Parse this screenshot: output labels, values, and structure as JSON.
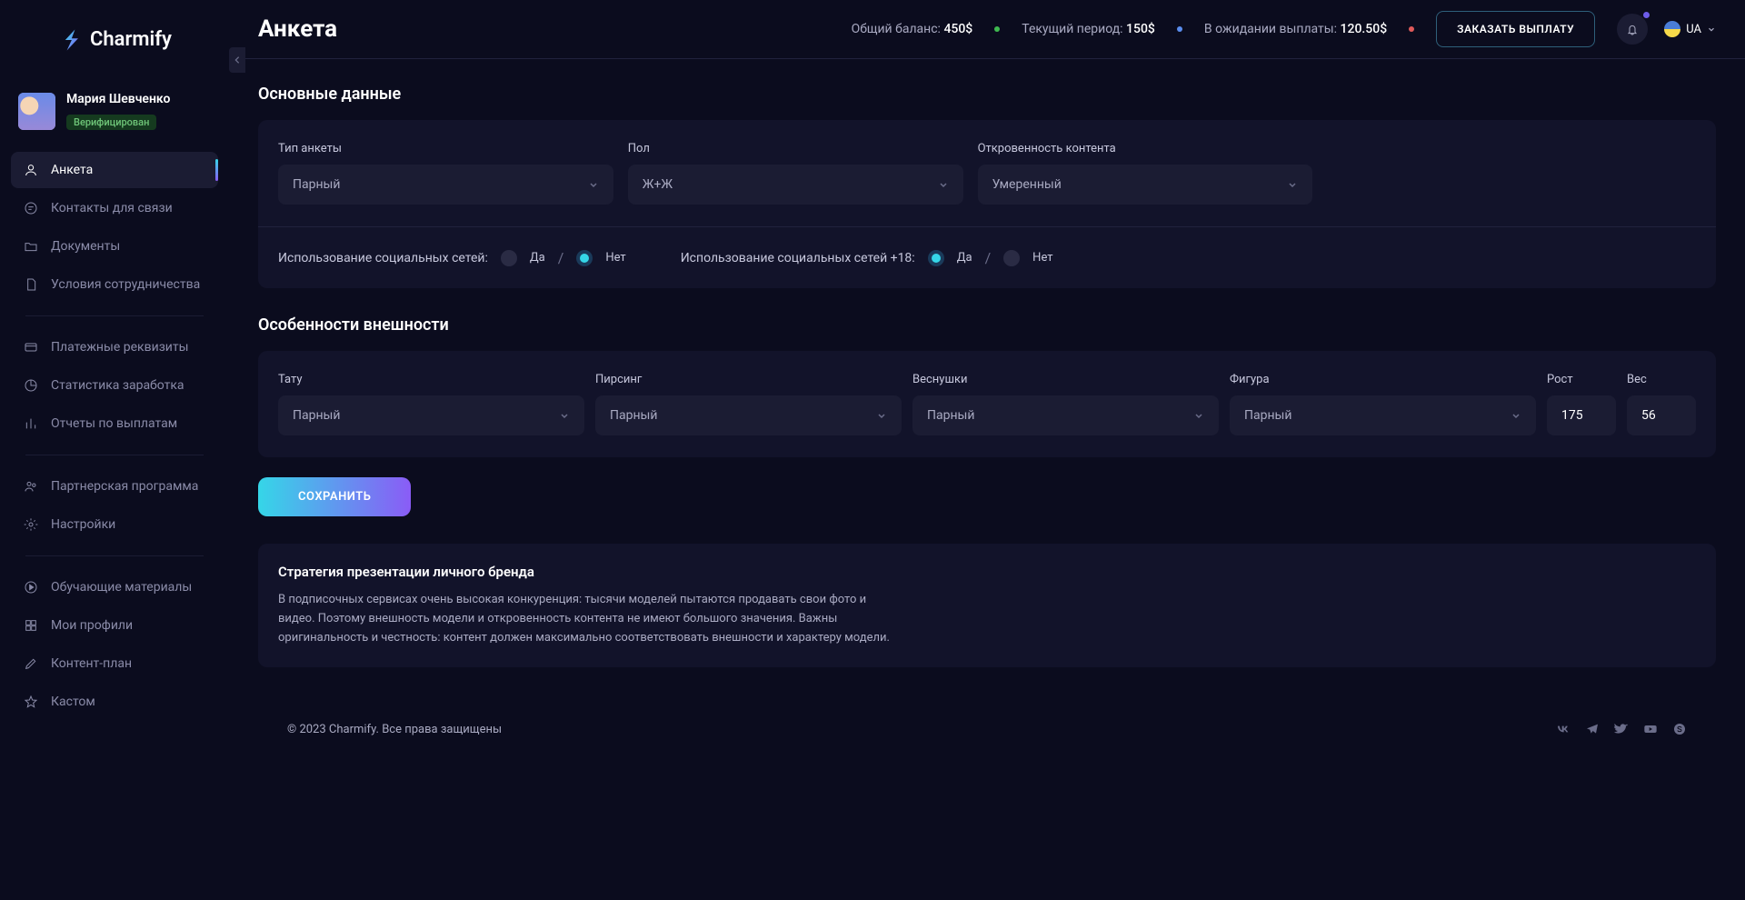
{
  "brand": "Charmify",
  "user": {
    "name": "Мария Шевченко",
    "badge": "Верифицирован"
  },
  "nav": {
    "group1": [
      {
        "label": "Анкета"
      },
      {
        "label": "Контакты для связи"
      },
      {
        "label": "Документы"
      },
      {
        "label": "Условия сотрудничества"
      }
    ],
    "group2": [
      {
        "label": "Платежные реквизиты"
      },
      {
        "label": "Статистика заработка"
      },
      {
        "label": "Отчеты по выплатам"
      }
    ],
    "group3": [
      {
        "label": "Партнерская программа"
      },
      {
        "label": "Настройки"
      }
    ],
    "group4": [
      {
        "label": "Обучающие материалы"
      },
      {
        "label": "Мои профили"
      },
      {
        "label": "Контент-план"
      },
      {
        "label": "Кастом"
      }
    ]
  },
  "header": {
    "title": "Анкета",
    "balance_label": "Общий баланс:",
    "balance_value": "450$",
    "period_label": "Текущий период:",
    "period_value": "150$",
    "pending_label": "В ожидании выплаты:",
    "pending_value": "120.50$",
    "request_btn": "ЗАКАЗАТЬ ВЫПЛАТУ",
    "lang": "UA"
  },
  "sections": {
    "basic_title": "Основные данные",
    "appearance_title": "Особенности внешности"
  },
  "fields": {
    "profile_type": {
      "label": "Тип анкеты",
      "value": "Парный"
    },
    "gender": {
      "label": "Пол",
      "value": "Ж+Ж"
    },
    "explicitness": {
      "label": "Откровенность контента",
      "value": "Умеренный"
    },
    "social_label": "Использование социальных сетей:",
    "social18_label": "Использование социальных сетей +18:",
    "yes": "Да",
    "no": "Нет",
    "tattoo": {
      "label": "Тату",
      "value": "Парный"
    },
    "piercing": {
      "label": "Пирсинг",
      "value": "Парный"
    },
    "freckles": {
      "label": "Веснушки",
      "value": "Парный"
    },
    "figure": {
      "label": "Фигура",
      "value": "Парный"
    },
    "height": {
      "label": "Рост",
      "value": "175"
    },
    "weight": {
      "label": "Вес",
      "value": "56"
    }
  },
  "save_btn": "СОХРАНИТЬ",
  "info": {
    "title": "Стратегия презентации личного бренда",
    "body": "В подписочных сервисах очень высокая конкуренция: тысячи моделей пытаются продавать свои фото и видео. Поэтому внешность модели и откровенность контента не имеют большого значения. Важны оригинальность и честность: контент должен максимально соответствовать внешности и характеру модели."
  },
  "footer": "© 2023 Charmify. Все права защищены"
}
